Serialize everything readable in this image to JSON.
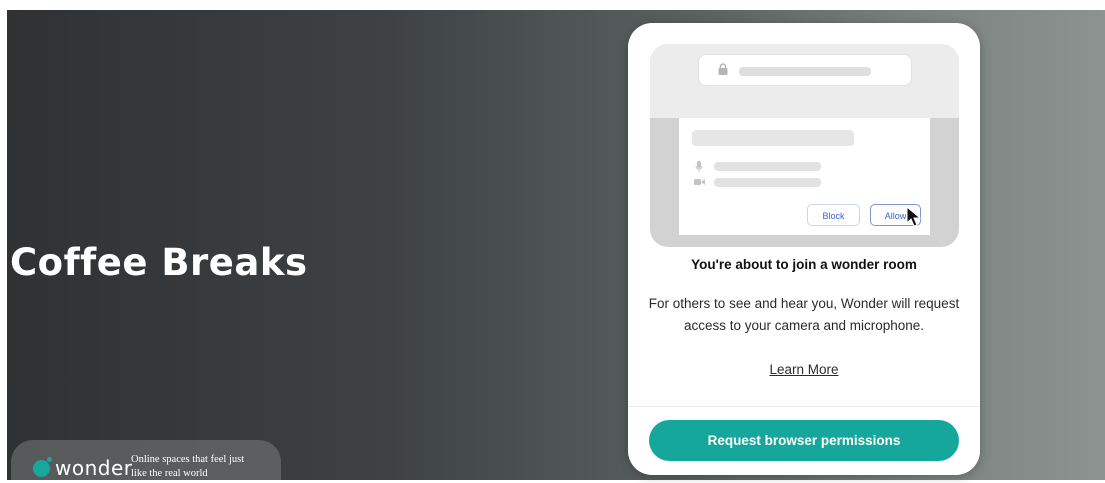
{
  "room": {
    "title": "Coffee Breaks"
  },
  "brand": {
    "name": "wonder",
    "tagline": "Online spaces that feel just like the real world",
    "accent": "#15a79b"
  },
  "illustration": {
    "block_label": "Block",
    "allow_label": "Allow",
    "icons": [
      "lock-icon",
      "microphone-icon",
      "camera-icon",
      "cursor-icon"
    ]
  },
  "modal": {
    "headline": "You're about to join a wonder room",
    "description": "For others to see and hear you, Wonder will request access to your camera and microphone.",
    "learn_more": "Learn More",
    "cta_label": "Request browser permissions"
  }
}
